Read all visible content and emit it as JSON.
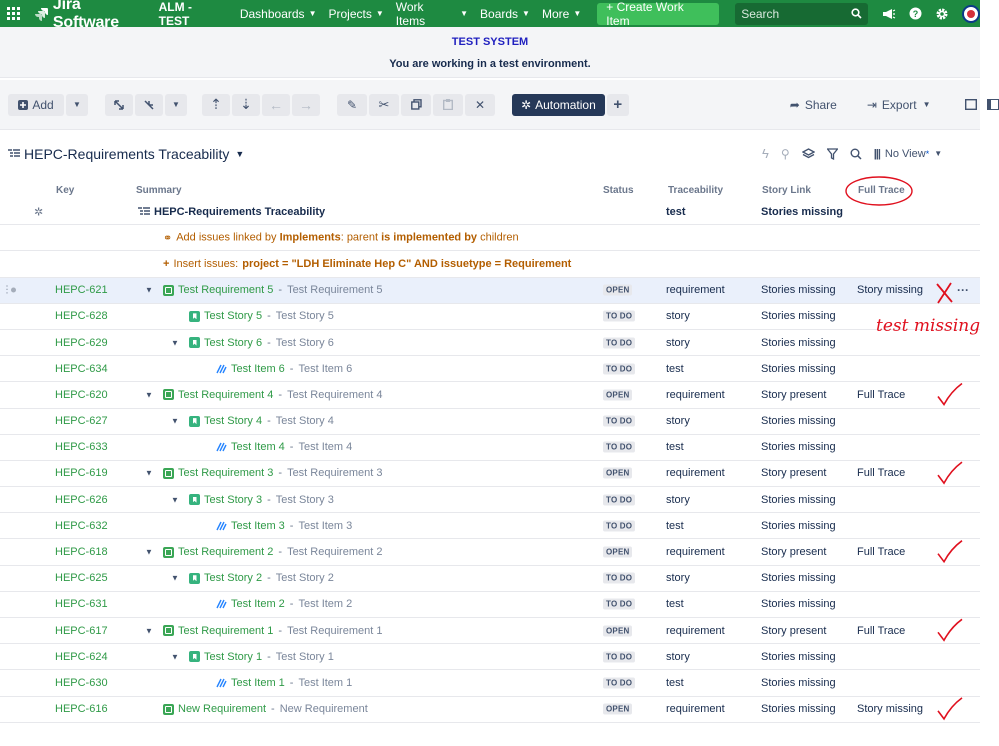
{
  "nav": {
    "product": "Jira Software",
    "site": "ALM - TEST",
    "menus": [
      "Dashboards",
      "Projects",
      "Work Items",
      "Boards",
      "More"
    ],
    "create_label": "+ Create Work Item",
    "search_placeholder": "Search"
  },
  "banner": {
    "title": "TEST SYSTEM",
    "message": "You are working in a test environment."
  },
  "toolbar": {
    "add_label": "Add",
    "automation_label": "Automation",
    "share_label": "Share",
    "export_label": "Export"
  },
  "structure": {
    "title": "HEPC-Requirements Traceability",
    "view_label": "No View"
  },
  "columns": {
    "key": "Key",
    "summary": "Summary",
    "status": "Status",
    "traceability": "Traceability",
    "story_link": "Story Link",
    "full_trace": "Full Trace"
  },
  "root_row": {
    "summary": "HEPC-Requirements Traceability",
    "traceability": "test",
    "story_link": "Stories missing"
  },
  "generator_rows": {
    "linked_prefix": "Add issues linked by",
    "linked_type": "Implements",
    "linked_colon": ": parent",
    "linked_rel": "is implemented by",
    "linked_suffix": "children",
    "insert_prefix": "Insert issues:",
    "insert_query": "project = \"LDH Eliminate Hep C\" AND issuetype = Requirement"
  },
  "rows": [
    {
      "key": "HEPC-621",
      "level": 0,
      "type": "req",
      "expand": true,
      "name": "Test Requirement 5",
      "sub": "Test Requirement 5",
      "status": "OPEN",
      "trace": "requirement",
      "link": "Stories missing",
      "full": "Story missing",
      "selected": true
    },
    {
      "key": "HEPC-628",
      "level": 1,
      "type": "story",
      "expand": false,
      "name": "Test Story 5",
      "sub": "Test Story 5",
      "status": "TO DO",
      "trace": "story",
      "link": "Stories missing",
      "full": ""
    },
    {
      "key": "HEPC-629",
      "level": 1,
      "type": "story",
      "expand": true,
      "name": "Test Story 6",
      "sub": "Test Story 6",
      "status": "TO DO",
      "trace": "story",
      "link": "Stories missing",
      "full": ""
    },
    {
      "key": "HEPC-634",
      "level": 2,
      "type": "test",
      "expand": false,
      "name": "Test Item 6",
      "sub": "Test Item 6",
      "status": "TO DO",
      "trace": "test",
      "link": "Stories missing",
      "full": ""
    },
    {
      "key": "HEPC-620",
      "level": 0,
      "type": "req",
      "expand": true,
      "name": "Test Requirement 4",
      "sub": "Test Requirement 4",
      "status": "OPEN",
      "trace": "requirement",
      "link": "Story present",
      "full": "Full Trace"
    },
    {
      "key": "HEPC-627",
      "level": 1,
      "type": "story",
      "expand": true,
      "name": "Test Story 4",
      "sub": "Test Story 4",
      "status": "TO DO",
      "trace": "story",
      "link": "Stories missing",
      "full": ""
    },
    {
      "key": "HEPC-633",
      "level": 2,
      "type": "test",
      "expand": false,
      "name": "Test Item 4",
      "sub": "Test Item 4",
      "status": "TO DO",
      "trace": "test",
      "link": "Stories missing",
      "full": ""
    },
    {
      "key": "HEPC-619",
      "level": 0,
      "type": "req",
      "expand": true,
      "name": "Test Requirement 3",
      "sub": "Test Requirement 3",
      "status": "OPEN",
      "trace": "requirement",
      "link": "Story present",
      "full": "Full Trace"
    },
    {
      "key": "HEPC-626",
      "level": 1,
      "type": "story",
      "expand": true,
      "name": "Test Story 3",
      "sub": "Test Story 3",
      "status": "TO DO",
      "trace": "story",
      "link": "Stories missing",
      "full": ""
    },
    {
      "key": "HEPC-632",
      "level": 2,
      "type": "test",
      "expand": false,
      "name": "Test Item 3",
      "sub": "Test Item 3",
      "status": "TO DO",
      "trace": "test",
      "link": "Stories missing",
      "full": ""
    },
    {
      "key": "HEPC-618",
      "level": 0,
      "type": "req",
      "expand": true,
      "name": "Test Requirement 2",
      "sub": "Test Requirement 2",
      "status": "OPEN",
      "trace": "requirement",
      "link": "Story present",
      "full": "Full Trace"
    },
    {
      "key": "HEPC-625",
      "level": 1,
      "type": "story",
      "expand": true,
      "name": "Test Story 2",
      "sub": "Test Story 2",
      "status": "TO DO",
      "trace": "story",
      "link": "Stories missing",
      "full": ""
    },
    {
      "key": "HEPC-631",
      "level": 2,
      "type": "test",
      "expand": false,
      "name": "Test Item 2",
      "sub": "Test Item 2",
      "status": "TO DO",
      "trace": "test",
      "link": "Stories missing",
      "full": ""
    },
    {
      "key": "HEPC-617",
      "level": 0,
      "type": "req",
      "expand": true,
      "name": "Test Requirement 1",
      "sub": "Test Requirement 1",
      "status": "OPEN",
      "trace": "requirement",
      "link": "Story present",
      "full": "Full Trace"
    },
    {
      "key": "HEPC-624",
      "level": 1,
      "type": "story",
      "expand": true,
      "name": "Test Story 1",
      "sub": "Test Story 1",
      "status": "TO DO",
      "trace": "story",
      "link": "Stories missing",
      "full": ""
    },
    {
      "key": "HEPC-630",
      "level": 2,
      "type": "test",
      "expand": false,
      "name": "Test Item 1",
      "sub": "Test Item 1",
      "status": "TO DO",
      "trace": "test",
      "link": "Stories missing",
      "full": ""
    },
    {
      "key": "HEPC-616",
      "level": 0,
      "type": "req",
      "expand": false,
      "name": "New Requirement",
      "sub": "New Requirement",
      "status": "OPEN",
      "trace": "requirement",
      "link": "Stories missing",
      "full": "Story missing"
    }
  ],
  "annotations": {
    "handwritten_note": "test missing",
    "color": "#e0101e"
  },
  "colors": {
    "nav_bg": "#1e8a41",
    "create_btn": "#3fbf5b",
    "issue_key": "#2f9a47",
    "automation_btn": "#253858",
    "banner_title": "#1f1fbf"
  }
}
